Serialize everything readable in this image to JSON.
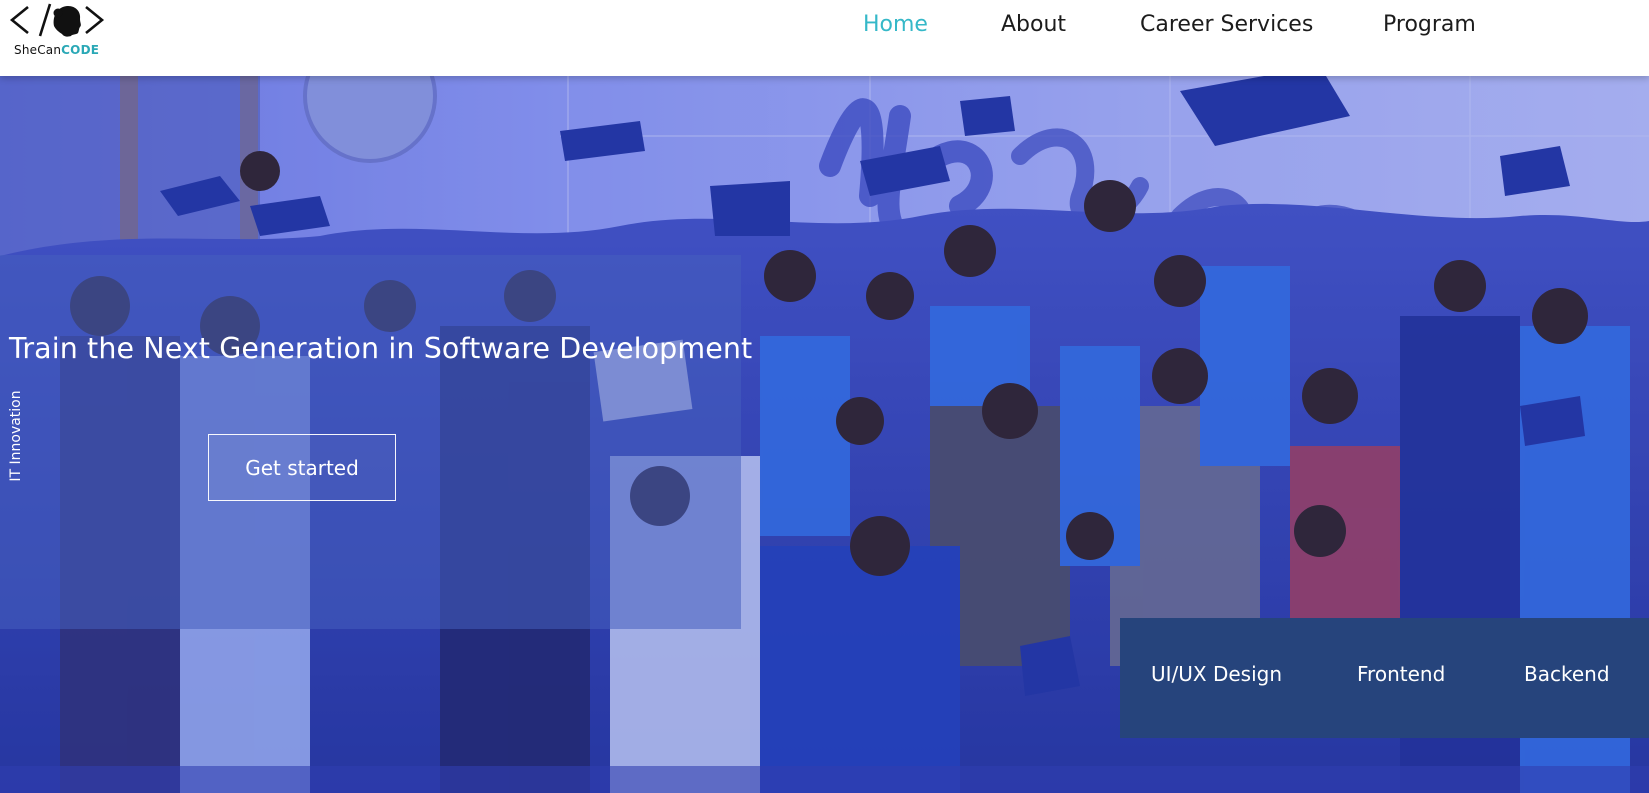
{
  "logo": {
    "brand_prefix": "SheCan",
    "brand_suffix": "CODE"
  },
  "nav": {
    "items": [
      {
        "label": "Home",
        "active": true
      },
      {
        "label": "About",
        "active": false
      },
      {
        "label": "Career Services",
        "active": false
      },
      {
        "label": "Program",
        "active": false
      }
    ]
  },
  "hero": {
    "side_label": "IT Innovation",
    "title": "Train the Next Generation in Software Development",
    "cta_label": "Get started",
    "background": "graduation-group-photo"
  },
  "tracks": {
    "items": [
      {
        "label": "UI/UX Design"
      },
      {
        "label": "Frontend"
      },
      {
        "label": "Backend"
      }
    ]
  },
  "colors": {
    "accent": "#35b8c8",
    "nav_text": "#1c1c1c",
    "overlay": "#465fbe",
    "track_panel": "#26447c"
  }
}
